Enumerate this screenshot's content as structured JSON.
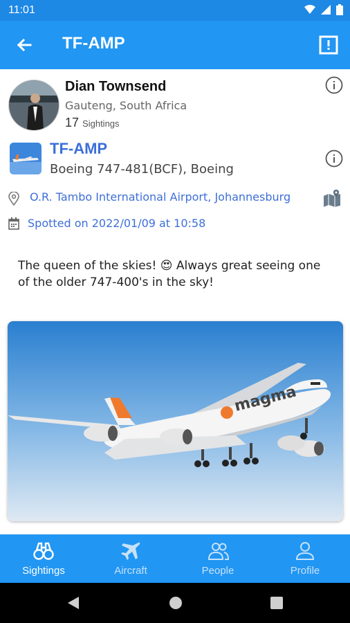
{
  "status": {
    "time": "11:01"
  },
  "appbar": {
    "title": "TF-AMP"
  },
  "user": {
    "name": "Dian Townsend",
    "location": "Gauteng, South Africa",
    "sightings_count": "17",
    "sightings_label": "Sightings"
  },
  "aircraft": {
    "registration": "TF-AMP",
    "model": "Boeing 747-481(BCF), Boeing"
  },
  "sighting": {
    "airport": "O.R. Tambo International Airport, Johannesburg",
    "date": "Spotted on 2022/01/09",
    "time": "at 10:58"
  },
  "caption": {
    "line1": "The queen of the skies! 😍 Always great seeing one",
    "line2": "of the older 747-400's in the sky!"
  },
  "photo": {
    "livery": "magma"
  },
  "nav": {
    "items": [
      {
        "label": "Sightings"
      },
      {
        "label": "Aircraft"
      },
      {
        "label": "People"
      },
      {
        "label": "Profile"
      }
    ]
  },
  "colors": {
    "primary": "#2196f3",
    "status_bar": "#1e88e5",
    "link": "#3d6fd8"
  }
}
